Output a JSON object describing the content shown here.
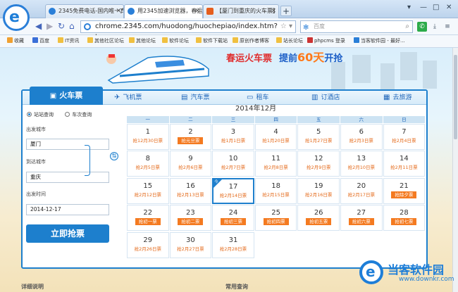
{
  "browser": {
    "tabs": [
      {
        "label": "2345免费电话-国内唯一真正"
      },
      {
        "label": "用2345加速浏览器，春运火"
      },
      {
        "label": "【厦门到重庆的火车票】重"
      }
    ],
    "new_tab": "+",
    "window_controls": [
      "▾",
      "—",
      "□",
      "✕"
    ],
    "address": "chrome.2345.com/huodong/huochepiao/index.htm?banner",
    "address_marks": "☆ ▾",
    "search_placeholder": "百度",
    "bookmarks": [
      "收藏",
      "百度",
      "IT资讯",
      "其他社区论坛",
      "其他论坛",
      "软件论坛",
      "软件下载站",
      "原创作者博客",
      "站长论坛",
      "phpcms 登录",
      "当客软件园 - 最好..."
    ]
  },
  "banner": {
    "text1": "春运火车票",
    "text2": "提前",
    "days": "60天",
    "text3": "开抢"
  },
  "service_tabs": [
    {
      "label": "火车票",
      "icon": "train-icon"
    },
    {
      "label": "飞机票",
      "icon": "plane-icon"
    },
    {
      "label": "汽车票",
      "icon": "bus-icon"
    },
    {
      "label": "租车",
      "icon": "car-icon"
    },
    {
      "label": "订酒店",
      "icon": "hotel-icon"
    },
    {
      "label": "去旅游",
      "icon": "travel-icon"
    }
  ],
  "form": {
    "radio_station": "站站查询",
    "radio_train": "车次查询",
    "from_label": "出发城市",
    "from_value": "厦门",
    "to_label": "到达城市",
    "to_value": "重庆",
    "date_label": "出发时间",
    "date_value": "2014-12-17",
    "submit": "立即抢票"
  },
  "calendar": {
    "title": "2014年12月",
    "weekdays": [
      "一",
      "二",
      "三",
      "四",
      "五",
      "六",
      "日"
    ],
    "today_badge": "今",
    "days": [
      {
        "d": "1",
        "l": "抢12月30日票",
        "tag": false
      },
      {
        "d": "2",
        "l": "抢元旦票",
        "tag": true
      },
      {
        "d": "3",
        "l": "抢1月1日票",
        "tag": false
      },
      {
        "d": "4",
        "l": "抢1月20日票",
        "tag": false
      },
      {
        "d": "5",
        "l": "抢1月27日票",
        "tag": false
      },
      {
        "d": "6",
        "l": "抢2月3日票",
        "tag": false
      },
      {
        "d": "7",
        "l": "抢2月4日票",
        "tag": false
      },
      {
        "d": "8",
        "l": "抢2月5日票",
        "tag": false
      },
      {
        "d": "9",
        "l": "抢2月6日票",
        "tag": false
      },
      {
        "d": "10",
        "l": "抢2月7日票",
        "tag": false
      },
      {
        "d": "11",
        "l": "抢2月8日票",
        "tag": false
      },
      {
        "d": "12",
        "l": "抢2月9日票",
        "tag": false
      },
      {
        "d": "13",
        "l": "抢2月10日票",
        "tag": false
      },
      {
        "d": "14",
        "l": "抢2月11日票",
        "tag": false
      },
      {
        "d": "15",
        "l": "抢2月12日票",
        "tag": false
      },
      {
        "d": "16",
        "l": "抢2月13日票",
        "tag": false
      },
      {
        "d": "17",
        "l": "抢2月14日票",
        "tag": false,
        "today": true
      },
      {
        "d": "18",
        "l": "抢2月15日票",
        "tag": false
      },
      {
        "d": "19",
        "l": "抢2月16日票",
        "tag": false
      },
      {
        "d": "20",
        "l": "抢2月17日票",
        "tag": false
      },
      {
        "d": "21",
        "l": "抢除夕票",
        "tag": true
      },
      {
        "d": "22",
        "l": "抢初一票",
        "tag": true
      },
      {
        "d": "23",
        "l": "抢初二票",
        "tag": true
      },
      {
        "d": "24",
        "l": "抢初三票",
        "tag": true
      },
      {
        "d": "25",
        "l": "抢初四票",
        "tag": true
      },
      {
        "d": "26",
        "l": "抢初五票",
        "tag": true
      },
      {
        "d": "27",
        "l": "抢初六票",
        "tag": true
      },
      {
        "d": "28",
        "l": "抢初七票",
        "tag": true
      },
      {
        "d": "29",
        "l": "抢2月26日票",
        "tag": false
      },
      {
        "d": "30",
        "l": "抢2月27日票",
        "tag": false
      },
      {
        "d": "31",
        "l": "抢2月28日票",
        "tag": false
      }
    ]
  },
  "footer": {
    "details": "详细说明",
    "common_query": "常用查询"
  },
  "watermark": {
    "name": "当客软件园",
    "url": "www.downkr.com"
  }
}
